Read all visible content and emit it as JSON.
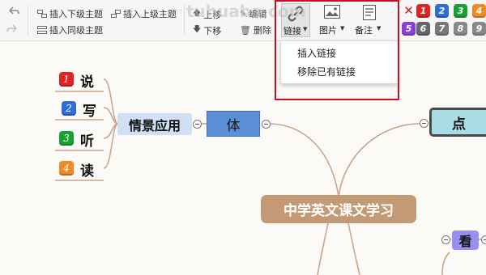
{
  "toolbar": {
    "insert_child": "插入下级主题",
    "insert_parent": "插入上级主题",
    "insert_sibling": "插入同级主题",
    "move_up": "上移",
    "move_down": "下移",
    "edit": "编辑",
    "delete": "删除",
    "link": "链接",
    "image": "图片",
    "note": "备注"
  },
  "watermark": "tuhuaba.com",
  "dropdown": {
    "items": [
      "插入链接",
      "移除已有链接"
    ]
  },
  "markers": {
    "row1": [
      "1",
      "2",
      "3",
      "4"
    ],
    "row2": [
      "5",
      "6",
      "7",
      "8",
      "9"
    ]
  },
  "mindmap": {
    "central": "中学英文课文学习",
    "branch_left": "体",
    "branch_left_child": "情景应用",
    "branch_right": "点",
    "branch_bottom": "看",
    "leaves": [
      {
        "num": "1",
        "text": "说"
      },
      {
        "num": "2",
        "text": "写"
      },
      {
        "num": "3",
        "text": "听"
      },
      {
        "num": "4",
        "text": "读"
      }
    ]
  },
  "colors": {
    "central": "#c49a76",
    "branch_left": "#5b8fd8",
    "branch_right": "#a9dce5",
    "branch_left_child": "#cfe0f4",
    "branch_bottom": "#9a8ff0",
    "line": "#c9a58a",
    "red_badge": "#e02424",
    "blue_badge": "#2d6fd6",
    "green_badge": "#19a035",
    "orange_badge": "#ef8a24",
    "highlight_box": "#c8101f"
  }
}
